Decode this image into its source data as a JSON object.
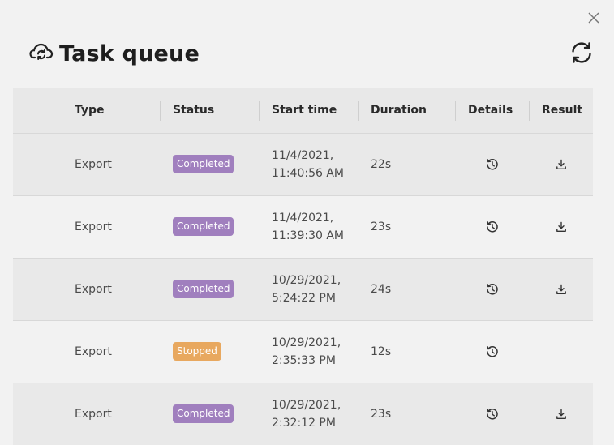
{
  "dialog": {
    "title": "Task queue"
  },
  "icons": {
    "title": "cloud-sync-icon",
    "refresh": "refresh-icon",
    "close": "close-icon",
    "details": "history-icon",
    "result": "download-icon"
  },
  "colors": {
    "completed": "#a07fbe",
    "stopped": "#e8a85f"
  },
  "table": {
    "headers": [
      "Type",
      "Status",
      "Start time",
      "Duration",
      "Details",
      "Result"
    ],
    "rows": [
      {
        "type": "Export",
        "status": "Completed",
        "start_line1": "11/4/2021,",
        "start_line2": "11:40:56 AM",
        "duration": "22s",
        "has_result": true
      },
      {
        "type": "Export",
        "status": "Completed",
        "start_line1": "11/4/2021,",
        "start_line2": "11:39:30 AM",
        "duration": "23s",
        "has_result": true
      },
      {
        "type": "Export",
        "status": "Completed",
        "start_line1": "10/29/2021,",
        "start_line2": "5:24:22 PM",
        "duration": "24s",
        "has_result": true
      },
      {
        "type": "Export",
        "status": "Stopped",
        "start_line1": "10/29/2021,",
        "start_line2": "2:35:33 PM",
        "duration": "12s",
        "has_result": false
      },
      {
        "type": "Export",
        "status": "Completed",
        "start_line1": "10/29/2021,",
        "start_line2": "2:32:12 PM",
        "duration": "23s",
        "has_result": true
      }
    ]
  }
}
